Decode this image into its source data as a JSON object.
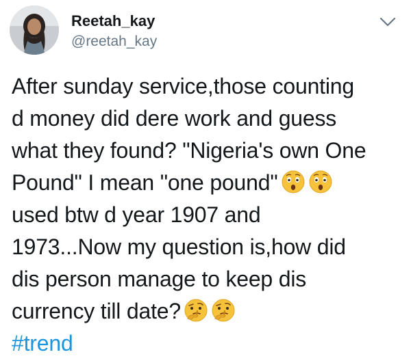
{
  "user": {
    "display_name": "Reetah_kay",
    "handle": "@reetah_kay"
  },
  "tweet": {
    "lines": [
      "After sunday service,those counting",
      "d money did dere work and guess",
      "what they found? \"Nigeria's own One",
      "Pound\" I mean \"one pound\"",
      "used btw d year 1907 and",
      "1973...Now my question is,how did",
      "dis person manage to keep dis",
      "currency till date?"
    ],
    "hashtag": "#trend"
  },
  "icons": {
    "menu": "chevron-down-icon",
    "emoji_1": "astonished-face-emoji",
    "emoji_2": "thinking-face-emoji"
  },
  "colors": {
    "link": "#1b95e0",
    "secondary_text": "#657786",
    "primary_text": "#14171a"
  }
}
